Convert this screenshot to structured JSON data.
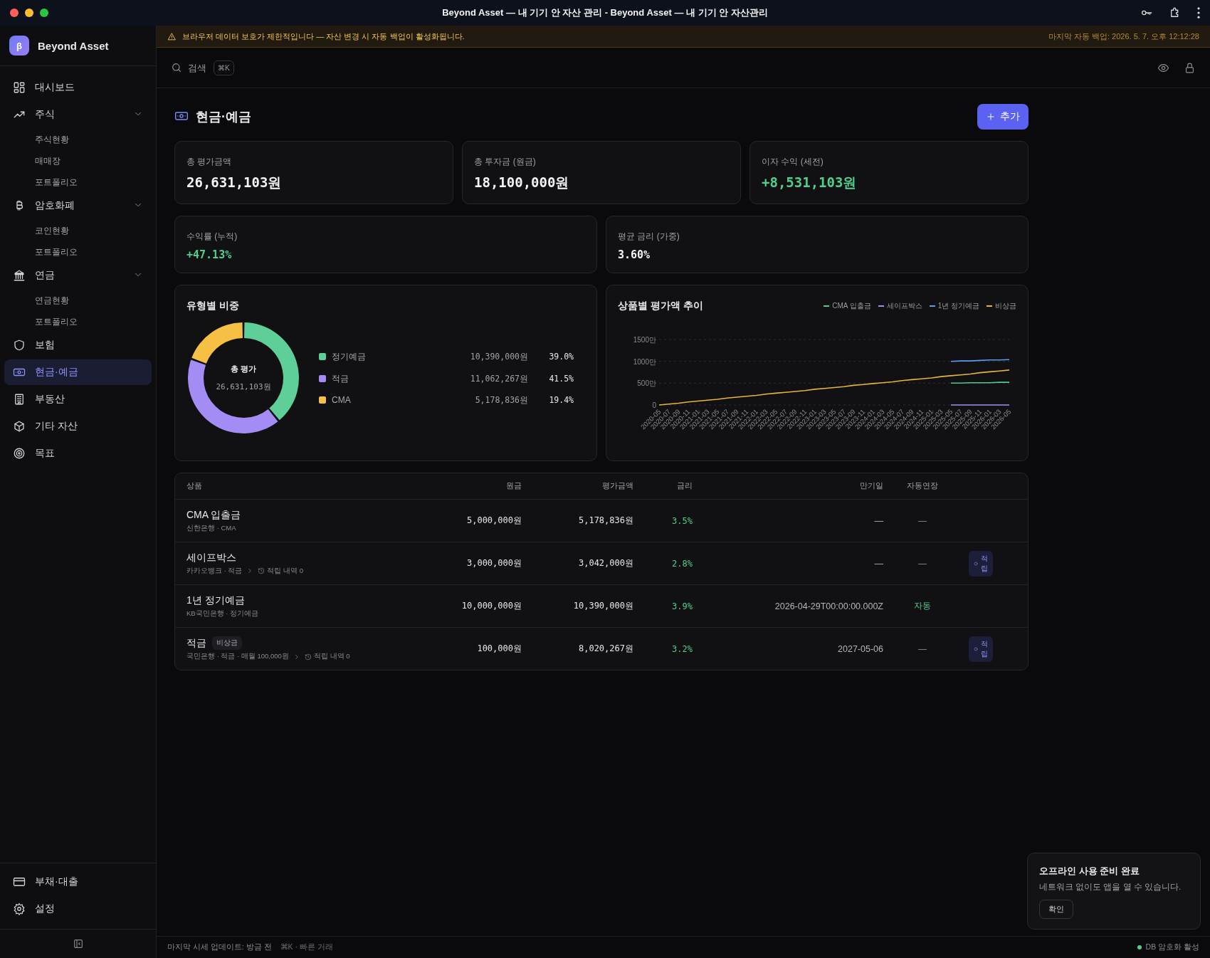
{
  "window": {
    "title": "Beyond Asset — 내 기기 안 자산 관리 - Beyond Asset — 내 기기 안 자산관리"
  },
  "sidebar": {
    "brand": {
      "logo": "β",
      "name": "Beyond Asset"
    },
    "items": [
      {
        "label": "대시보드",
        "selected": false
      },
      {
        "label": "주식",
        "selected": false,
        "expanded": true,
        "children": [
          {
            "label": "주식현황",
            "selected": false
          },
          {
            "label": "매매장",
            "selected": false
          },
          {
            "label": "포트폴리오",
            "selected": false
          }
        ]
      },
      {
        "label": "암호화폐",
        "selected": false,
        "expanded": true,
        "children": [
          {
            "label": "코인현황",
            "selected": false
          },
          {
            "label": "포트폴리오",
            "selected": false
          }
        ]
      },
      {
        "label": "연금",
        "selected": false,
        "expanded": true,
        "children": [
          {
            "label": "연금현황",
            "selected": false
          },
          {
            "label": "포트폴리오",
            "selected": false
          }
        ]
      },
      {
        "label": "보험",
        "selected": false
      },
      {
        "label": "현금·예금",
        "selected": true
      },
      {
        "label": "부동산",
        "selected": false
      },
      {
        "label": "기타 자산",
        "selected": false
      },
      {
        "label": "목표",
        "selected": false
      }
    ],
    "bottom_items": [
      {
        "label": "부채·대출",
        "selected": false
      },
      {
        "label": "설정",
        "selected": false
      }
    ]
  },
  "banner": {
    "message": "브라우저 데이터 보호가 제한적입니다 — 자산 변경 시 자동 백업이 활성화됩니다.",
    "backup": "마지막 자동 백업: 2026. 5. 7. 오후 12:12:28"
  },
  "search": {
    "placeholder": "검색",
    "shortcut": "⌘K"
  },
  "page": {
    "title": "현금·예금",
    "add_button": "추가"
  },
  "stats": [
    {
      "label": "총 평가금액",
      "value": "26,631,103원",
      "positive": false
    },
    {
      "label": "총 투자금 (원금)",
      "value": "18,100,000원",
      "positive": false
    },
    {
      "label": "이자 수익 (세전)",
      "value": "+8,531,103원",
      "positive": true
    }
  ],
  "stats_row2": [
    {
      "label": "수익률 (누적)",
      "value": "+47.13%",
      "positive": true
    },
    {
      "label": "평균 금리 (가중)",
      "value": "3.60%",
      "positive": false
    }
  ],
  "allocation": {
    "title": "유형별 비중",
    "center_label": "총 평가",
    "center_value": "26,631,103원",
    "legend": [
      {
        "color": "#5ecf98",
        "amount": "10,390,000원",
        "share": "39.0%"
      },
      {
        "color": "#a48cf5",
        "amount": "11,062,267원",
        "share": "41.5%"
      },
      {
        "color": "#f5c044",
        "amount": "5,178,836원",
        "share": "19.4%"
      }
    ],
    "chart_data": {
      "type": "donut",
      "categories": [
        "정기예금",
        "적금",
        "CMA"
      ],
      "values": [
        39.0,
        41.5,
        19.4
      ]
    }
  },
  "trend": {
    "title": "상품별 평가액 추이",
    "chart_data": {
      "type": "line",
      "categories": [
        "2020-05",
        "2020-07",
        "2020-09",
        "2020-11",
        "2021-01",
        "2021-03",
        "2021-05",
        "2021-07",
        "2021-09",
        "2021-11",
        "2022-01",
        "2022-03",
        "2022-05",
        "2022-07",
        "2022-09",
        "2022-11",
        "2023-01",
        "2023-03",
        "2023-05",
        "2023-07",
        "2023-09",
        "2023-11",
        "2024-01",
        "2024-03",
        "2024-05",
        "2024-07",
        "2024-09",
        "2024-11",
        "2025-01",
        "2025-03",
        "2025-05",
        "2025-07",
        "2025-09",
        "2025-11",
        "2026-01",
        "2026-03",
        "2026-05"
      ],
      "ylim": [
        0,
        1500
      ],
      "yticks": [
        {
          "value": 0,
          "label": "0"
        },
        {
          "value": 500,
          "label": "500만"
        },
        {
          "value": 1000,
          "label": "1000만"
        },
        {
          "value": 1500,
          "label": "1500만"
        }
      ],
      "series": [
        {
          "name": "CMA 입출금",
          "color": "#4fc98c",
          "values": [
            null,
            null,
            null,
            null,
            null,
            null,
            null,
            null,
            null,
            null,
            null,
            null,
            null,
            null,
            null,
            null,
            null,
            null,
            null,
            null,
            null,
            null,
            null,
            null,
            null,
            null,
            null,
            null,
            null,
            null,
            500,
            500,
            510,
            510,
            510,
            520,
            520
          ]
        },
        {
          "name": "세이프박스",
          "color": "#a48cf5",
          "values": [
            null,
            null,
            null,
            null,
            null,
            null,
            null,
            null,
            null,
            null,
            null,
            null,
            null,
            null,
            null,
            null,
            null,
            null,
            null,
            null,
            null,
            null,
            null,
            null,
            null,
            null,
            null,
            null,
            null,
            null,
            0,
            0,
            0,
            0,
            0,
            0,
            0
          ]
        },
        {
          "name": "1년 정기예금",
          "color": "#5b9cf0",
          "values": [
            null,
            null,
            null,
            null,
            null,
            null,
            null,
            null,
            null,
            null,
            null,
            null,
            null,
            null,
            null,
            null,
            null,
            null,
            null,
            null,
            null,
            null,
            null,
            null,
            null,
            null,
            null,
            null,
            null,
            null,
            1000,
            1010,
            1010,
            1020,
            1030,
            1030,
            1040
          ]
        },
        {
          "name": "비상금",
          "color": "#e9b434",
          "values": [
            0,
            20,
            40,
            70,
            90,
            110,
            130,
            160,
            180,
            200,
            220,
            250,
            270,
            290,
            310,
            330,
            360,
            380,
            400,
            420,
            450,
            470,
            490,
            510,
            530,
            560,
            580,
            600,
            620,
            650,
            670,
            690,
            710,
            740,
            760,
            780,
            800
          ]
        }
      ]
    }
  },
  "table": {
    "columns": [
      "상품",
      "원금",
      "평가금액",
      "금리",
      "만기일",
      "자동연장"
    ],
    "rows": [
      {
        "name": "CMA 입출금",
        "details": "신한은행 · CMA",
        "principal": "5,000,000원",
        "value": "5,178,836원",
        "rate": "3.5%",
        "maturity": "—",
        "auto_renew": {
          "label": "—",
          "on": false
        }
      },
      {
        "name": "세이프박스",
        "details": "카카오뱅크 · 적금",
        "history": "적립 내역 0",
        "principal": "3,000,000원",
        "value": "3,042,000원",
        "rate": "2.8%",
        "maturity": "—",
        "auto_renew": {
          "label": "—",
          "on": false
        },
        "action": "적립"
      },
      {
        "name": "1년 정기예금",
        "details": "KB국민은행 · 정기예금",
        "principal": "10,000,000원",
        "value": "10,390,000원",
        "rate": "3.9%",
        "maturity": "2026-04-29T00:00:00.000Z",
        "auto_renew": {
          "label": "자동",
          "on": true
        }
      },
      {
        "name": "적금",
        "tag": "비상금",
        "details": "국민은행 · 적금 · 매월 100,000원",
        "history": "적립 내역 0",
        "principal": "100,000원",
        "value": "8,020,267원",
        "rate": "3.2%",
        "maturity": "2027-05-06",
        "auto_renew": {
          "label": "—",
          "on": false
        },
        "action": "적립"
      }
    ]
  },
  "status_bar": {
    "update": "마지막 시세 업데이트: 방금 전",
    "shortcut": "⌘K · 빠른 거래",
    "encryption": "DB 암호화 활성"
  },
  "toast": {
    "title": "오프라인 사용 준비 완료",
    "message": "네트워크 없이도 앱을 열 수 있습니다.",
    "button": "확인"
  }
}
